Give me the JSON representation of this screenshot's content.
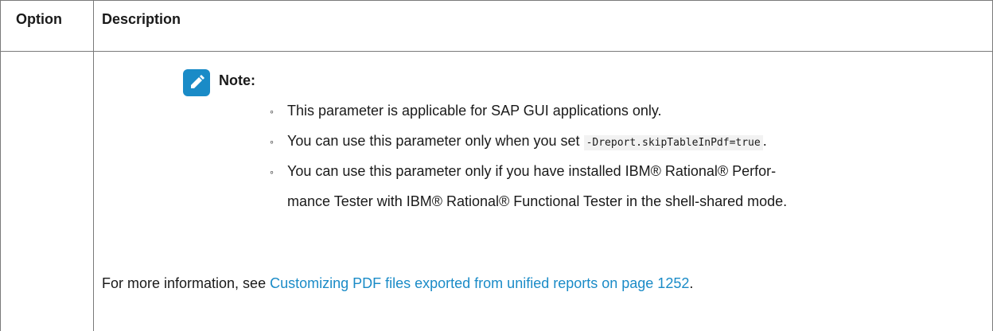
{
  "table": {
    "headers": {
      "option": "Option",
      "description": "Description"
    }
  },
  "note": {
    "icon": "pencil-note-icon",
    "label": "Note:",
    "items": [
      {
        "text": "This parameter is applicable for SAP GUI applications only."
      },
      {
        "text_before": "You can use this parameter only when you set ",
        "code": "-Dreport.skipTableInPdf=true",
        "text_after": "."
      },
      {
        "line1": "You can use this parameter only if you have installed IBM® Rational® Perfor-",
        "line2": "mance Tester with IBM® Rational® Functional Tester in the shell-shared mode."
      }
    ],
    "bullet_glyph": "◦"
  },
  "more_info": {
    "prefix": "For more information, see ",
    "link_text": "Customizing PDF files exported from unified reports on page 1252",
    "suffix": "."
  },
  "colors": {
    "link": "#1a8bc7",
    "icon_bg": "#1a8bc7",
    "border": "#7a7a7a",
    "code_bg": "#f2f2f2"
  }
}
